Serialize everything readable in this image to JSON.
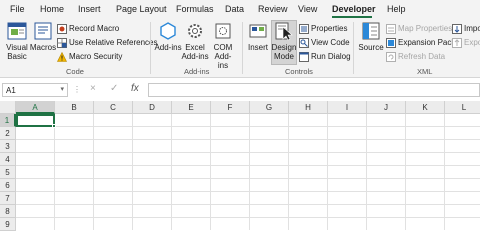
{
  "tabs": [
    "File",
    "Home",
    "Insert",
    "Page Layout",
    "Formulas",
    "Data",
    "Review",
    "View",
    "Developer",
    "Help"
  ],
  "active_tab": "Developer",
  "accent_color": "#1f7244",
  "ribbon": {
    "code": {
      "visual_basic": "Visual Basic",
      "macros": "Macros",
      "record_macro": "Record Macro",
      "use_relative": "Use Relative References",
      "macro_security": "Macro Security",
      "group_label": "Code"
    },
    "addins": {
      "addins": "Add-ins",
      "excel_addins": "Excel Add-ins",
      "com_addins": "COM Add-ins",
      "group_label": "Add-ins"
    },
    "controls": {
      "insert": "Insert",
      "design_mode": "Design Mode",
      "properties": "Properties",
      "view_code": "View Code",
      "run_dialog": "Run Dialog",
      "group_label": "Controls"
    },
    "xml": {
      "source": "Source",
      "map_properties": "Map Properties",
      "expansion_packs": "Expansion Packs",
      "refresh_data": "Refresh Data",
      "import": "Import",
      "export": "Export",
      "group_label": "XML"
    }
  },
  "formula_bar": {
    "name_box": "A1",
    "cancel_icon": "×",
    "enter_icon": "✓",
    "fx_icon": "fx",
    "content": ""
  },
  "grid": {
    "columns": [
      "A",
      "B",
      "C",
      "D",
      "E",
      "F",
      "G",
      "H",
      "I",
      "J",
      "K",
      "L"
    ],
    "rows": [
      "1",
      "2",
      "3",
      "4",
      "5",
      "6",
      "7",
      "8",
      "9"
    ],
    "active_cell": "A1"
  }
}
